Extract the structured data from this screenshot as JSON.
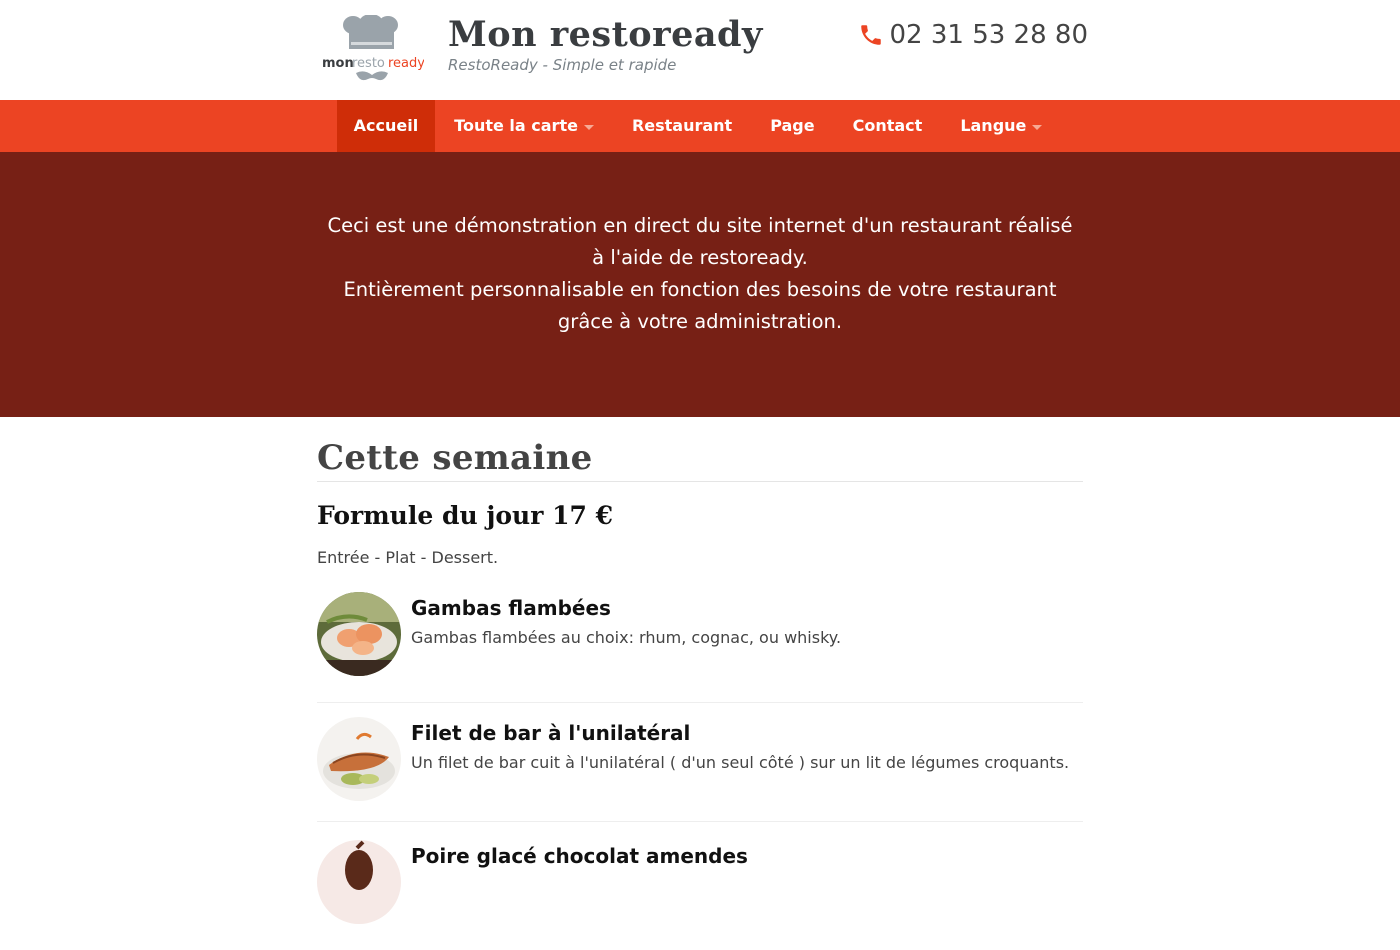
{
  "header": {
    "logo_text": "mon restoready",
    "site_title": "Mon restoready",
    "tagline": "RestoReady - Simple et rapide",
    "phone": "02 31 53 28 80"
  },
  "nav": {
    "items": [
      {
        "label": "Accueil"
      },
      {
        "label": "Toute la carte"
      },
      {
        "label": "Restaurant"
      },
      {
        "label": "Page"
      },
      {
        "label": "Contact"
      },
      {
        "label": "Langue"
      }
    ]
  },
  "hero": {
    "line1": "Ceci est une démonstration en direct du site internet d'un restaurant réalisé à l'aide de restoready.",
    "line2": "Entièrement personnalisable en fonction des besoins de votre restaurant grâce à votre administration."
  },
  "main": {
    "section_title": "Cette semaine",
    "formula_title": "Formule du jour 17 €",
    "formula_desc": "Entrée - Plat - Dessert.",
    "dishes": [
      {
        "name": "Gambas flambées",
        "desc": "Gambas flambées au choix: rhum, cognac, ou whisky."
      },
      {
        "name": "Filet de bar à l'unilatéral",
        "desc": "Un filet de bar cuit à l'unilatéral ( d'un seul côté ) sur un lit de légumes croquants."
      },
      {
        "name": "Poire glacé chocolat amendes",
        "desc": ""
      }
    ]
  },
  "colors": {
    "nav_bg": "#ec4423",
    "nav_active": "#cf2d08",
    "hero_bg": "#772015",
    "phone_icon": "#ec4423"
  }
}
